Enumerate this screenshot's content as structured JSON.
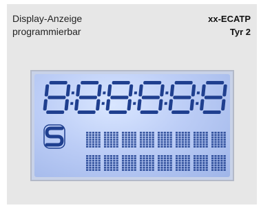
{
  "header": {
    "title_line1": "Display-Anzeige",
    "title_line2": "programmierbar",
    "model_line1": "xx-ECATP",
    "model_line2": "Tyr 2"
  },
  "lcd": {
    "digit_count": 6,
    "matrix_columns": 8,
    "matrix_rows": 2,
    "segment_color": "#1f3f8f",
    "background_color": "#c3d1f3",
    "symbol_icon": "s-logo-icon"
  }
}
